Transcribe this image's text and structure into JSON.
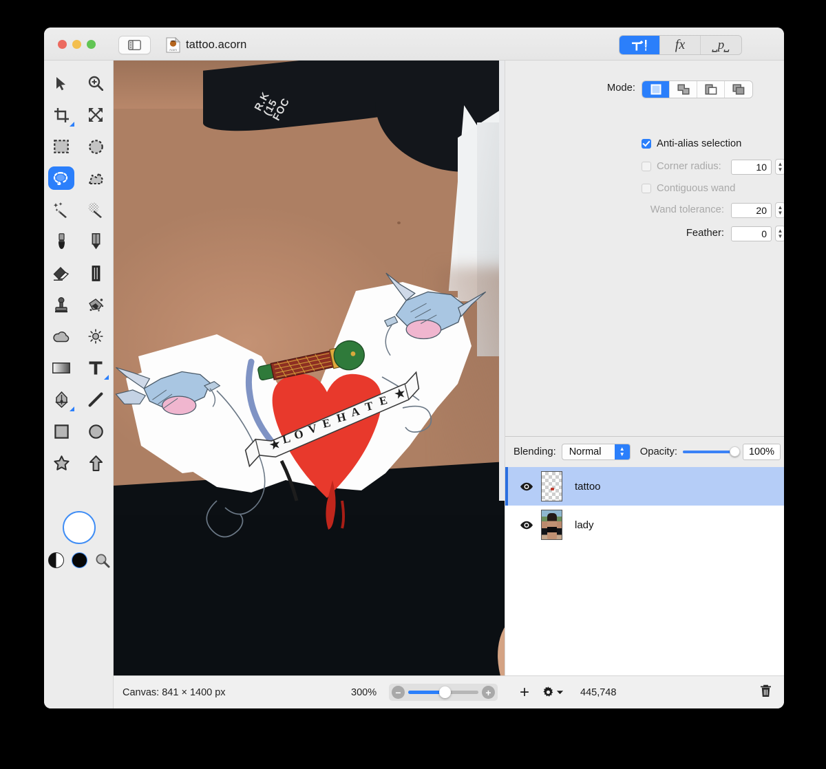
{
  "window": {
    "title": "tattoo.acorn",
    "traffic_lights": [
      "close",
      "minimize",
      "zoom"
    ],
    "sidebar_toggle_icon": "sidebar-toggle-icon",
    "document_icon": "acorn-document-icon"
  },
  "inspector_tabs": [
    {
      "id": "tools",
      "label": "⚒",
      "icon": "tool-options-icon",
      "active": true
    },
    {
      "id": "filters",
      "label": "fx",
      "icon": "fx-icon",
      "active": false
    },
    {
      "id": "palette",
      "label": "p",
      "icon": "palette-icon",
      "active": false
    }
  ],
  "tools": [
    {
      "name": "move-tool",
      "icon": "arrow-cursor-icon",
      "selected": false
    },
    {
      "name": "zoom-tool",
      "icon": "magnifier-plus-icon",
      "selected": false
    },
    {
      "name": "crop-tool",
      "icon": "crop-icon",
      "selected": false,
      "has_options": true
    },
    {
      "name": "transform-tool",
      "icon": "move-arrows-icon",
      "selected": false
    },
    {
      "name": "rectangular-select-tool",
      "icon": "marquee-rect-icon",
      "selected": false
    },
    {
      "name": "elliptical-select-tool",
      "icon": "marquee-ellipse-icon",
      "selected": false
    },
    {
      "name": "lasso-select-tool",
      "icon": "lasso-icon",
      "selected": true
    },
    {
      "name": "polygon-select-tool",
      "icon": "polygon-lasso-icon",
      "selected": false
    },
    {
      "name": "magic-wand-tool",
      "icon": "magic-wand-icon",
      "selected": false
    },
    {
      "name": "instant-alpha-tool",
      "icon": "instant-alpha-icon",
      "selected": false
    },
    {
      "name": "brush-tool",
      "icon": "brush-icon",
      "selected": false
    },
    {
      "name": "pencil-tool",
      "icon": "pencil-icon",
      "selected": false
    },
    {
      "name": "eraser-tool",
      "icon": "eraser-icon",
      "selected": false
    },
    {
      "name": "smudge-tool",
      "icon": "smudge-icon",
      "selected": false
    },
    {
      "name": "clone-stamp-tool",
      "icon": "clone-stamp-icon",
      "selected": false
    },
    {
      "name": "paint-bucket-tool",
      "icon": "paint-bucket-icon",
      "selected": false
    },
    {
      "name": "blur-tool",
      "icon": "cloud-blur-icon",
      "selected": false
    },
    {
      "name": "dodge-burn-tool",
      "icon": "sun-dodge-icon",
      "selected": false
    },
    {
      "name": "gradient-tool",
      "icon": "gradient-icon",
      "selected": false
    },
    {
      "name": "text-tool",
      "icon": "text-t-icon",
      "selected": false,
      "has_options": true
    },
    {
      "name": "bezier-pen-tool",
      "icon": "pen-nib-icon",
      "selected": false,
      "has_options": true
    },
    {
      "name": "line-tool",
      "icon": "line-icon",
      "selected": false
    },
    {
      "name": "rectangle-shape-tool",
      "icon": "square-icon",
      "selected": false
    },
    {
      "name": "ellipse-shape-tool",
      "icon": "circle-icon",
      "selected": false
    },
    {
      "name": "star-shape-tool",
      "icon": "star-icon",
      "selected": false
    },
    {
      "name": "arrow-shape-tool",
      "icon": "arrow-up-icon",
      "selected": false
    }
  ],
  "color_swatches": {
    "foreground": "#ffffff",
    "foreground_outline": "#3f8df5",
    "swap_icon": "swap-colors-icon",
    "black_swatch": "#060606",
    "picker_icon": "color-picker-magnifier-icon"
  },
  "tool_options": {
    "mode_label": "Mode:",
    "modes": [
      {
        "name": "new-selection",
        "icon": "selection-new-icon",
        "active": true
      },
      {
        "name": "add-to-selection",
        "icon": "selection-add-icon",
        "active": false
      },
      {
        "name": "subtract-from-selection",
        "icon": "selection-subtract-icon",
        "active": false
      },
      {
        "name": "intersect-selection",
        "icon": "selection-intersect-icon",
        "active": false
      }
    ],
    "antialias": {
      "label": "Anti-alias selection",
      "checked": true,
      "enabled": true
    },
    "corner_radius": {
      "label": "Corner radius:",
      "value": "10",
      "checked": false,
      "enabled": false
    },
    "contiguous_wand": {
      "label": "Contiguous wand",
      "checked": false,
      "enabled": false
    },
    "wand_tolerance": {
      "label": "Wand tolerance:",
      "value": "20",
      "enabled": false
    },
    "feather": {
      "label": "Feather:",
      "value": "0",
      "enabled": true
    }
  },
  "layers_panel": {
    "blending_label": "Blending:",
    "blending_value": "Normal",
    "opacity_label": "Opacity:",
    "opacity_value": "100%",
    "opacity_pct": 100,
    "rows": [
      {
        "name": "tattoo",
        "visible": true,
        "selected": true,
        "thumb": "transparent-checker"
      },
      {
        "name": "lady",
        "visible": true,
        "selected": false,
        "thumb": "photo"
      }
    ]
  },
  "statusbar": {
    "canvas_label": "Canvas: 841 × 1400 px",
    "zoom_percent": "300%",
    "zoom_out_icon": "zoom-out-icon",
    "zoom_in_icon": "zoom-in-icon",
    "add_layer_icon": "plus-icon",
    "layer_actions_icon": "gear-icon",
    "memory_value": "445,748",
    "delete_icon": "trash-icon"
  },
  "canvas": {
    "artwork_description": "photo of a woman's midriff with a swallow-and-heart tattoo sticker layer"
  }
}
